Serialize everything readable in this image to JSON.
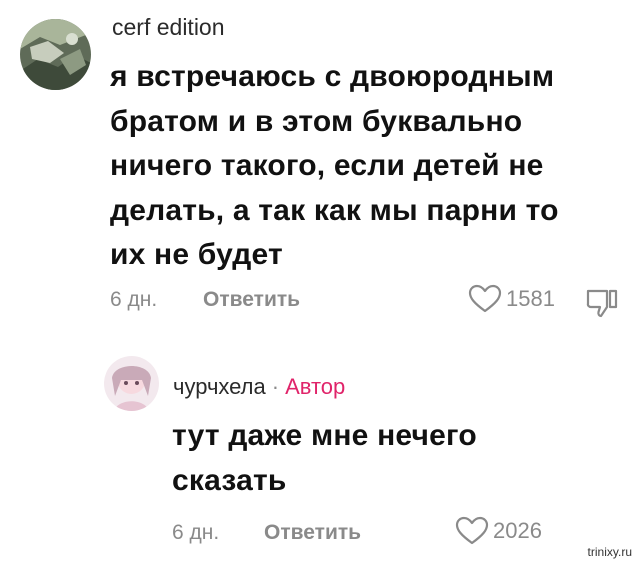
{
  "comments": [
    {
      "username": "cerf edition",
      "text_lines": [
        "я встречаюсь с двоюродным",
        "братом и в этом буквально",
        "ничего такого, если детей не",
        "делать, а так как мы парни то",
        "их не будет"
      ],
      "time": "6 дн.",
      "reply_label": "Ответить",
      "likes": "1581"
    },
    {
      "username": "чурчхела",
      "separator": "·",
      "author_badge": "Автор",
      "text_lines": [
        "тут даже мне нечего",
        "сказать"
      ],
      "time": "6 дн.",
      "reply_label": "Ответить",
      "likes": "2026"
    }
  ],
  "watermark": "trinixy.ru",
  "icons": {
    "like": "heart-outline-icon",
    "dislike": "thumbs-down-outline-icon"
  },
  "colors": {
    "author_badge": "#e0246a",
    "secondary_text": "#8a8a8a"
  }
}
